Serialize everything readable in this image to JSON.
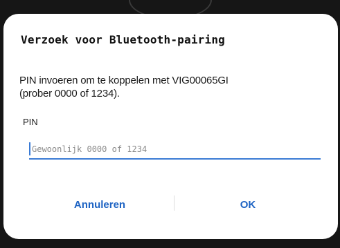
{
  "dialog": {
    "title": "Verzoek voor Bluetooth-pairing",
    "message_line1": "PIN invoeren om te koppelen met VIG00065GI",
    "message_line2": "(prober 0000 of 1234).",
    "pin_label": "PIN",
    "pin_placeholder": "Gewoonlijk 0000 of 1234",
    "pin_value": "",
    "cancel_label": "Annuleren",
    "ok_label": "OK"
  },
  "colors": {
    "accent": "#1d63c3",
    "input_underline": "#3a7bd5",
    "dialog_background": "#ffffff",
    "backdrop": "#161616"
  }
}
